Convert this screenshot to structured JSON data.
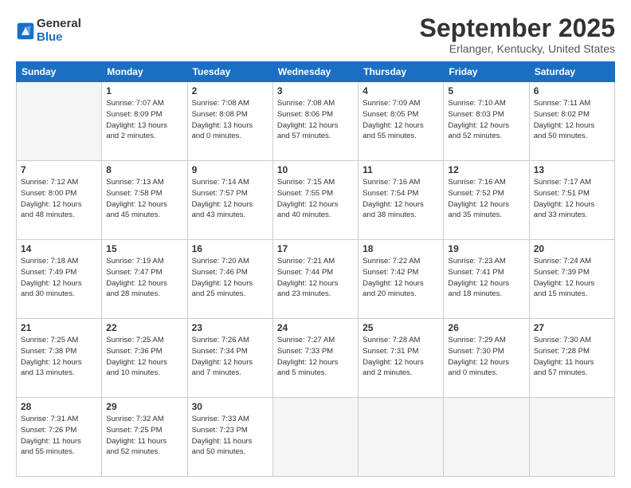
{
  "logo": {
    "general": "General",
    "blue": "Blue"
  },
  "title": "September 2025",
  "location": "Erlanger, Kentucky, United States",
  "days_of_week": [
    "Sunday",
    "Monday",
    "Tuesday",
    "Wednesday",
    "Thursday",
    "Friday",
    "Saturday"
  ],
  "weeks": [
    [
      {
        "day": "",
        "info": ""
      },
      {
        "day": "1",
        "info": "Sunrise: 7:07 AM\nSunset: 8:09 PM\nDaylight: 13 hours\nand 2 minutes."
      },
      {
        "day": "2",
        "info": "Sunrise: 7:08 AM\nSunset: 8:08 PM\nDaylight: 13 hours\nand 0 minutes."
      },
      {
        "day": "3",
        "info": "Sunrise: 7:08 AM\nSunset: 8:06 PM\nDaylight: 12 hours\nand 57 minutes."
      },
      {
        "day": "4",
        "info": "Sunrise: 7:09 AM\nSunset: 8:05 PM\nDaylight: 12 hours\nand 55 minutes."
      },
      {
        "day": "5",
        "info": "Sunrise: 7:10 AM\nSunset: 8:03 PM\nDaylight: 12 hours\nand 52 minutes."
      },
      {
        "day": "6",
        "info": "Sunrise: 7:11 AM\nSunset: 8:02 PM\nDaylight: 12 hours\nand 50 minutes."
      }
    ],
    [
      {
        "day": "7",
        "info": "Sunrise: 7:12 AM\nSunset: 8:00 PM\nDaylight: 12 hours\nand 48 minutes."
      },
      {
        "day": "8",
        "info": "Sunrise: 7:13 AM\nSunset: 7:58 PM\nDaylight: 12 hours\nand 45 minutes."
      },
      {
        "day": "9",
        "info": "Sunrise: 7:14 AM\nSunset: 7:57 PM\nDaylight: 12 hours\nand 43 minutes."
      },
      {
        "day": "10",
        "info": "Sunrise: 7:15 AM\nSunset: 7:55 PM\nDaylight: 12 hours\nand 40 minutes."
      },
      {
        "day": "11",
        "info": "Sunrise: 7:16 AM\nSunset: 7:54 PM\nDaylight: 12 hours\nand 38 minutes."
      },
      {
        "day": "12",
        "info": "Sunrise: 7:16 AM\nSunset: 7:52 PM\nDaylight: 12 hours\nand 35 minutes."
      },
      {
        "day": "13",
        "info": "Sunrise: 7:17 AM\nSunset: 7:51 PM\nDaylight: 12 hours\nand 33 minutes."
      }
    ],
    [
      {
        "day": "14",
        "info": "Sunrise: 7:18 AM\nSunset: 7:49 PM\nDaylight: 12 hours\nand 30 minutes."
      },
      {
        "day": "15",
        "info": "Sunrise: 7:19 AM\nSunset: 7:47 PM\nDaylight: 12 hours\nand 28 minutes."
      },
      {
        "day": "16",
        "info": "Sunrise: 7:20 AM\nSunset: 7:46 PM\nDaylight: 12 hours\nand 25 minutes."
      },
      {
        "day": "17",
        "info": "Sunrise: 7:21 AM\nSunset: 7:44 PM\nDaylight: 12 hours\nand 23 minutes."
      },
      {
        "day": "18",
        "info": "Sunrise: 7:22 AM\nSunset: 7:42 PM\nDaylight: 12 hours\nand 20 minutes."
      },
      {
        "day": "19",
        "info": "Sunrise: 7:23 AM\nSunset: 7:41 PM\nDaylight: 12 hours\nand 18 minutes."
      },
      {
        "day": "20",
        "info": "Sunrise: 7:24 AM\nSunset: 7:39 PM\nDaylight: 12 hours\nand 15 minutes."
      }
    ],
    [
      {
        "day": "21",
        "info": "Sunrise: 7:25 AM\nSunset: 7:38 PM\nDaylight: 12 hours\nand 13 minutes."
      },
      {
        "day": "22",
        "info": "Sunrise: 7:25 AM\nSunset: 7:36 PM\nDaylight: 12 hours\nand 10 minutes."
      },
      {
        "day": "23",
        "info": "Sunrise: 7:26 AM\nSunset: 7:34 PM\nDaylight: 12 hours\nand 7 minutes."
      },
      {
        "day": "24",
        "info": "Sunrise: 7:27 AM\nSunset: 7:33 PM\nDaylight: 12 hours\nand 5 minutes."
      },
      {
        "day": "25",
        "info": "Sunrise: 7:28 AM\nSunset: 7:31 PM\nDaylight: 12 hours\nand 2 minutes."
      },
      {
        "day": "26",
        "info": "Sunrise: 7:29 AM\nSunset: 7:30 PM\nDaylight: 12 hours\nand 0 minutes."
      },
      {
        "day": "27",
        "info": "Sunrise: 7:30 AM\nSunset: 7:28 PM\nDaylight: 11 hours\nand 57 minutes."
      }
    ],
    [
      {
        "day": "28",
        "info": "Sunrise: 7:31 AM\nSunset: 7:26 PM\nDaylight: 11 hours\nand 55 minutes."
      },
      {
        "day": "29",
        "info": "Sunrise: 7:32 AM\nSunset: 7:25 PM\nDaylight: 11 hours\nand 52 minutes."
      },
      {
        "day": "30",
        "info": "Sunrise: 7:33 AM\nSunset: 7:23 PM\nDaylight: 11 hours\nand 50 minutes."
      },
      {
        "day": "",
        "info": ""
      },
      {
        "day": "",
        "info": ""
      },
      {
        "day": "",
        "info": ""
      },
      {
        "day": "",
        "info": ""
      }
    ]
  ]
}
